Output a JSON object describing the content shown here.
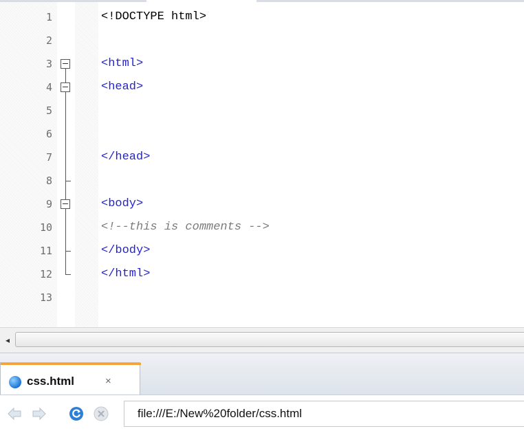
{
  "editor": {
    "lines": [
      {
        "num": "1",
        "text": "<!DOCTYPE html>",
        "kind": "doctype"
      },
      {
        "num": "2",
        "text": "",
        "kind": "blank"
      },
      {
        "num": "3",
        "text": "<html>",
        "kind": "tag",
        "fold": "box"
      },
      {
        "num": "4",
        "text": "<head>",
        "kind": "tag",
        "fold": "box"
      },
      {
        "num": "5",
        "text": "",
        "kind": "blank"
      },
      {
        "num": "6",
        "text": "",
        "kind": "blank"
      },
      {
        "num": "7",
        "text": "</head>",
        "kind": "tag"
      },
      {
        "num": "8",
        "text": "",
        "kind": "blank",
        "fold": "tick"
      },
      {
        "num": "9",
        "text": "<body>",
        "kind": "tag",
        "fold": "box"
      },
      {
        "num": "10",
        "text": "<!--this is comments -->",
        "kind": "comment"
      },
      {
        "num": "11",
        "text": "</body>",
        "kind": "tag",
        "fold": "tick"
      },
      {
        "num": "12",
        "text": "</html>",
        "kind": "tag",
        "fold": "end"
      },
      {
        "num": "13",
        "text": "",
        "kind": "blank"
      }
    ],
    "colors": {
      "tag": "#2323d8",
      "comment": "#7a7a7a",
      "doctype": "#000000",
      "line_number": "#6d6d6d"
    }
  },
  "scrollbar": {
    "left_arrow": "◂"
  },
  "tab": {
    "label": "css.html",
    "close": "×",
    "icon": "globe-icon",
    "accent": "#f2a33a"
  },
  "urlbar": {
    "back_icon": "back-arrow-icon",
    "forward_icon": "forward-arrow-icon",
    "reload_icon": "reload-icon",
    "stop_icon": "stop-icon",
    "url": "file:///E:/New%20folder/css.html"
  }
}
